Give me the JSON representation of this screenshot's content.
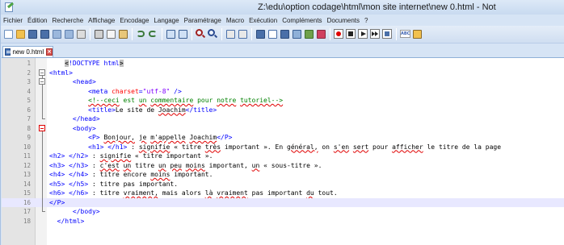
{
  "window": {
    "title": "Z:\\edu\\option codage\\html\\mon site internet\\new  0.html - Not"
  },
  "menu": {
    "items": [
      "Fichier",
      "Édition",
      "Recherche",
      "Affichage",
      "Encodage",
      "Langage",
      "Paramétrage",
      "Macro",
      "Exécution",
      "Compléments",
      "Documents",
      "?"
    ]
  },
  "toolbar": {
    "icons": [
      "new-file-icon",
      "open-file-icon",
      "save-icon",
      "save-all-icon",
      "close-icon",
      "close-all-icon",
      "print-icon",
      "cut-icon",
      "copy-icon",
      "paste-icon",
      "undo-icon",
      "redo-icon",
      "find-icon",
      "replace-icon",
      "zoom-in-icon",
      "zoom-out-icon",
      "sync-vertical-icon",
      "sync-horizontal-icon",
      "word-wrap-icon",
      "show-all-chars-icon",
      "indent-guide-icon",
      "doc-map-icon",
      "folder-workspace-icon",
      "function-list-icon",
      "record-macro-icon",
      "stop-macro-icon",
      "play-macro-icon",
      "run-macro-multiple-icon",
      "save-macro-icon",
      "spell-check-icon",
      "monitor-icon"
    ]
  },
  "tab": {
    "label": "new  0.html"
  },
  "editor": {
    "current_line": 16,
    "lines": [
      {
        "n": "1",
        "fold": "none",
        "segs": [
          [
            "tag",
            "    "
          ],
          [
            "hl",
            "<"
          ],
          [
            "tag",
            "!DOCTYPE html"
          ],
          [
            "hl",
            ">"
          ]
        ]
      },
      {
        "n": "2",
        "fold": "open",
        "segs": [
          [
            "tag",
            "<html>"
          ]
        ]
      },
      {
        "n": "3",
        "fold": "open",
        "segs": [
          [
            "tag",
            "      <head>"
          ]
        ]
      },
      {
        "n": "4",
        "fold": "line",
        "segs": [
          [
            "txt",
            "          "
          ],
          [
            "tag",
            "<meta "
          ],
          [
            "attr",
            "charset"
          ],
          [
            "tag",
            "="
          ],
          [
            "val",
            "\"utf-8\""
          ],
          [
            "tag",
            " />"
          ]
        ]
      },
      {
        "n": "5",
        "fold": "line",
        "segs": [
          [
            "txt",
            "          "
          ],
          [
            "cmt",
            "<!--ceci est un commentaire pour notre tutoriel-->"
          ]
        ]
      },
      {
        "n": "6",
        "fold": "line",
        "segs": [
          [
            "txt",
            "          "
          ],
          [
            "tag",
            "<title>"
          ],
          [
            "txt",
            "Le site de Joachim"
          ],
          [
            "tag",
            "</title>"
          ]
        ]
      },
      {
        "n": "7",
        "fold": "end",
        "segs": [
          [
            "txt",
            "      "
          ],
          [
            "tag",
            "</head>"
          ]
        ]
      },
      {
        "n": "8",
        "fold": "open-red",
        "segs": [
          [
            "txt",
            "      "
          ],
          [
            "tag",
            "<body>"
          ]
        ]
      },
      {
        "n": "9",
        "fold": "line",
        "segs": [
          [
            "txt",
            "          "
          ],
          [
            "tag",
            "<P>"
          ],
          [
            "txt",
            " Bonjour, je m'appelle Joachim"
          ],
          [
            "tag",
            "</P>"
          ]
        ]
      },
      {
        "n": "10",
        "fold": "line",
        "segs": [
          [
            "txt",
            "          "
          ],
          [
            "tag",
            "<h1>"
          ],
          [
            "txt",
            " "
          ],
          [
            "tag",
            "</h1>"
          ],
          [
            "txt",
            " : signifie « titre très important ». En général, on s'en sert pour afficher le titre de la page"
          ]
        ]
      },
      {
        "n": "11",
        "fold": "line",
        "segs": [
          [
            "tag",
            "<h2>"
          ],
          [
            "txt",
            " "
          ],
          [
            "tag",
            "</h2>"
          ],
          [
            "txt",
            " : signifie « titre important »."
          ]
        ]
      },
      {
        "n": "12",
        "fold": "line",
        "segs": [
          [
            "tag",
            "<h3>"
          ],
          [
            "txt",
            " "
          ],
          [
            "tag",
            "</h3>"
          ],
          [
            "txt",
            " : c'est un titre un peu moins important, un « sous-titre »."
          ]
        ]
      },
      {
        "n": "13",
        "fold": "line",
        "segs": [
          [
            "tag",
            "<h4>"
          ],
          [
            "txt",
            " "
          ],
          [
            "tag",
            "</h4>"
          ],
          [
            "txt",
            " : titre encore moins important."
          ]
        ]
      },
      {
        "n": "14",
        "fold": "line",
        "segs": [
          [
            "tag",
            "<h5>"
          ],
          [
            "txt",
            " "
          ],
          [
            "tag",
            "</h5>"
          ],
          [
            "txt",
            " : titre pas important."
          ]
        ]
      },
      {
        "n": "15",
        "fold": "line",
        "segs": [
          [
            "tag",
            "<h6>"
          ],
          [
            "txt",
            " "
          ],
          [
            "tag",
            "</h6>"
          ],
          [
            "txt",
            " : titre vraiment, mais alors là vraiment pas important du tout."
          ]
        ]
      },
      {
        "n": "16",
        "fold": "line",
        "segs": [
          [
            "tag",
            "</P>"
          ]
        ]
      },
      {
        "n": "17",
        "fold": "end",
        "segs": [
          [
            "txt",
            "      "
          ],
          [
            "tag",
            "</body>"
          ]
        ]
      },
      {
        "n": "18",
        "fold": "none",
        "segs": [
          [
            "txt",
            "  "
          ],
          [
            "tag",
            "</html>"
          ]
        ]
      }
    ]
  }
}
